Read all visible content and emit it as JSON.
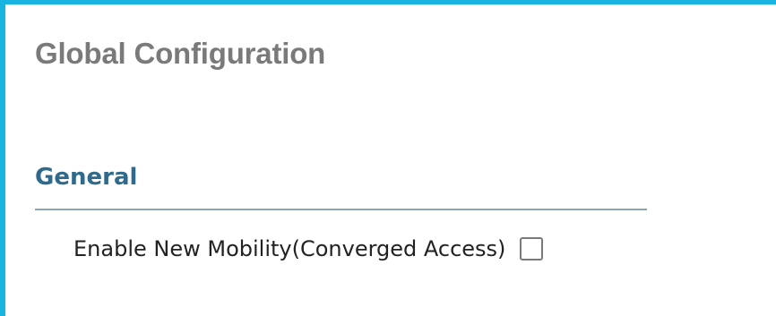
{
  "page": {
    "title": "Global Configuration"
  },
  "sections": [
    {
      "title": "General",
      "options": [
        {
          "label": "Enable New Mobility(Converged Access)",
          "checked": false
        }
      ]
    }
  ],
  "colors": {
    "frame_border": "#19b5e0",
    "page_title": "#7a7a7a",
    "section_title": "#2f6a8c",
    "divider": "#8fa3b6",
    "label_text": "#222222",
    "checkbox_border": "#7a7a7a"
  }
}
